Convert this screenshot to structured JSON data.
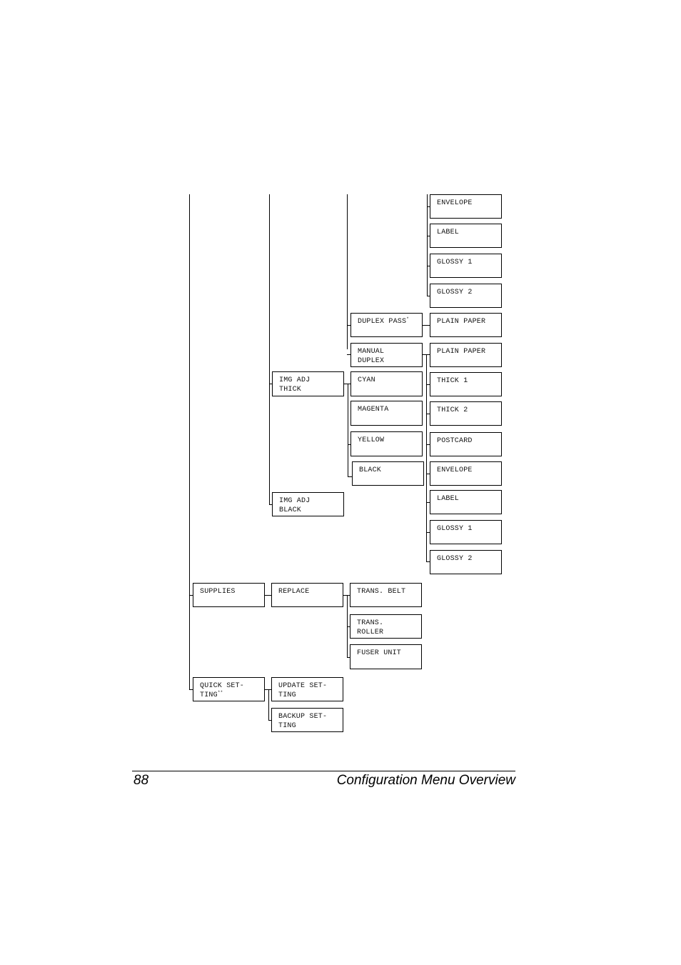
{
  "diagram": {
    "col4_top": [
      "ENVELOPE",
      "LABEL",
      "GLOSSY 1",
      "GLOSSY 2"
    ],
    "duplex_pass": {
      "label": "DUPLEX PASS",
      "footnote": "*",
      "child": "PLAIN PAPER"
    },
    "manual_duplex": {
      "label": "MANUAL\nDUPLEX",
      "children": [
        "PLAIN PAPER",
        "THICK 1",
        "THICK 2",
        "POSTCARD",
        "ENVELOPE",
        "LABEL",
        "GLOSSY 1",
        "GLOSSY 2"
      ]
    },
    "img_adj_thick": {
      "label": "IMG ADJ\nTHICK",
      "children": [
        "CYAN",
        "MAGENTA",
        "YELLOW",
        "BLACK"
      ]
    },
    "img_adj_black": {
      "label": "IMG ADJ\nBLACK"
    },
    "supplies": {
      "label": "SUPPLIES",
      "replace": {
        "label": "REPLACE",
        "children": [
          "TRANS. BELT",
          "TRANS.\nROLLER",
          "FUSER UNIT"
        ]
      }
    },
    "quick_setting": {
      "label": "QUICK SET-\nTING",
      "footnote": "**",
      "children": [
        "UPDATE SET-\nTING",
        "BACKUP SET-\nTING"
      ]
    }
  },
  "footer": {
    "page_number": "88",
    "title": "Configuration Menu Overview"
  }
}
